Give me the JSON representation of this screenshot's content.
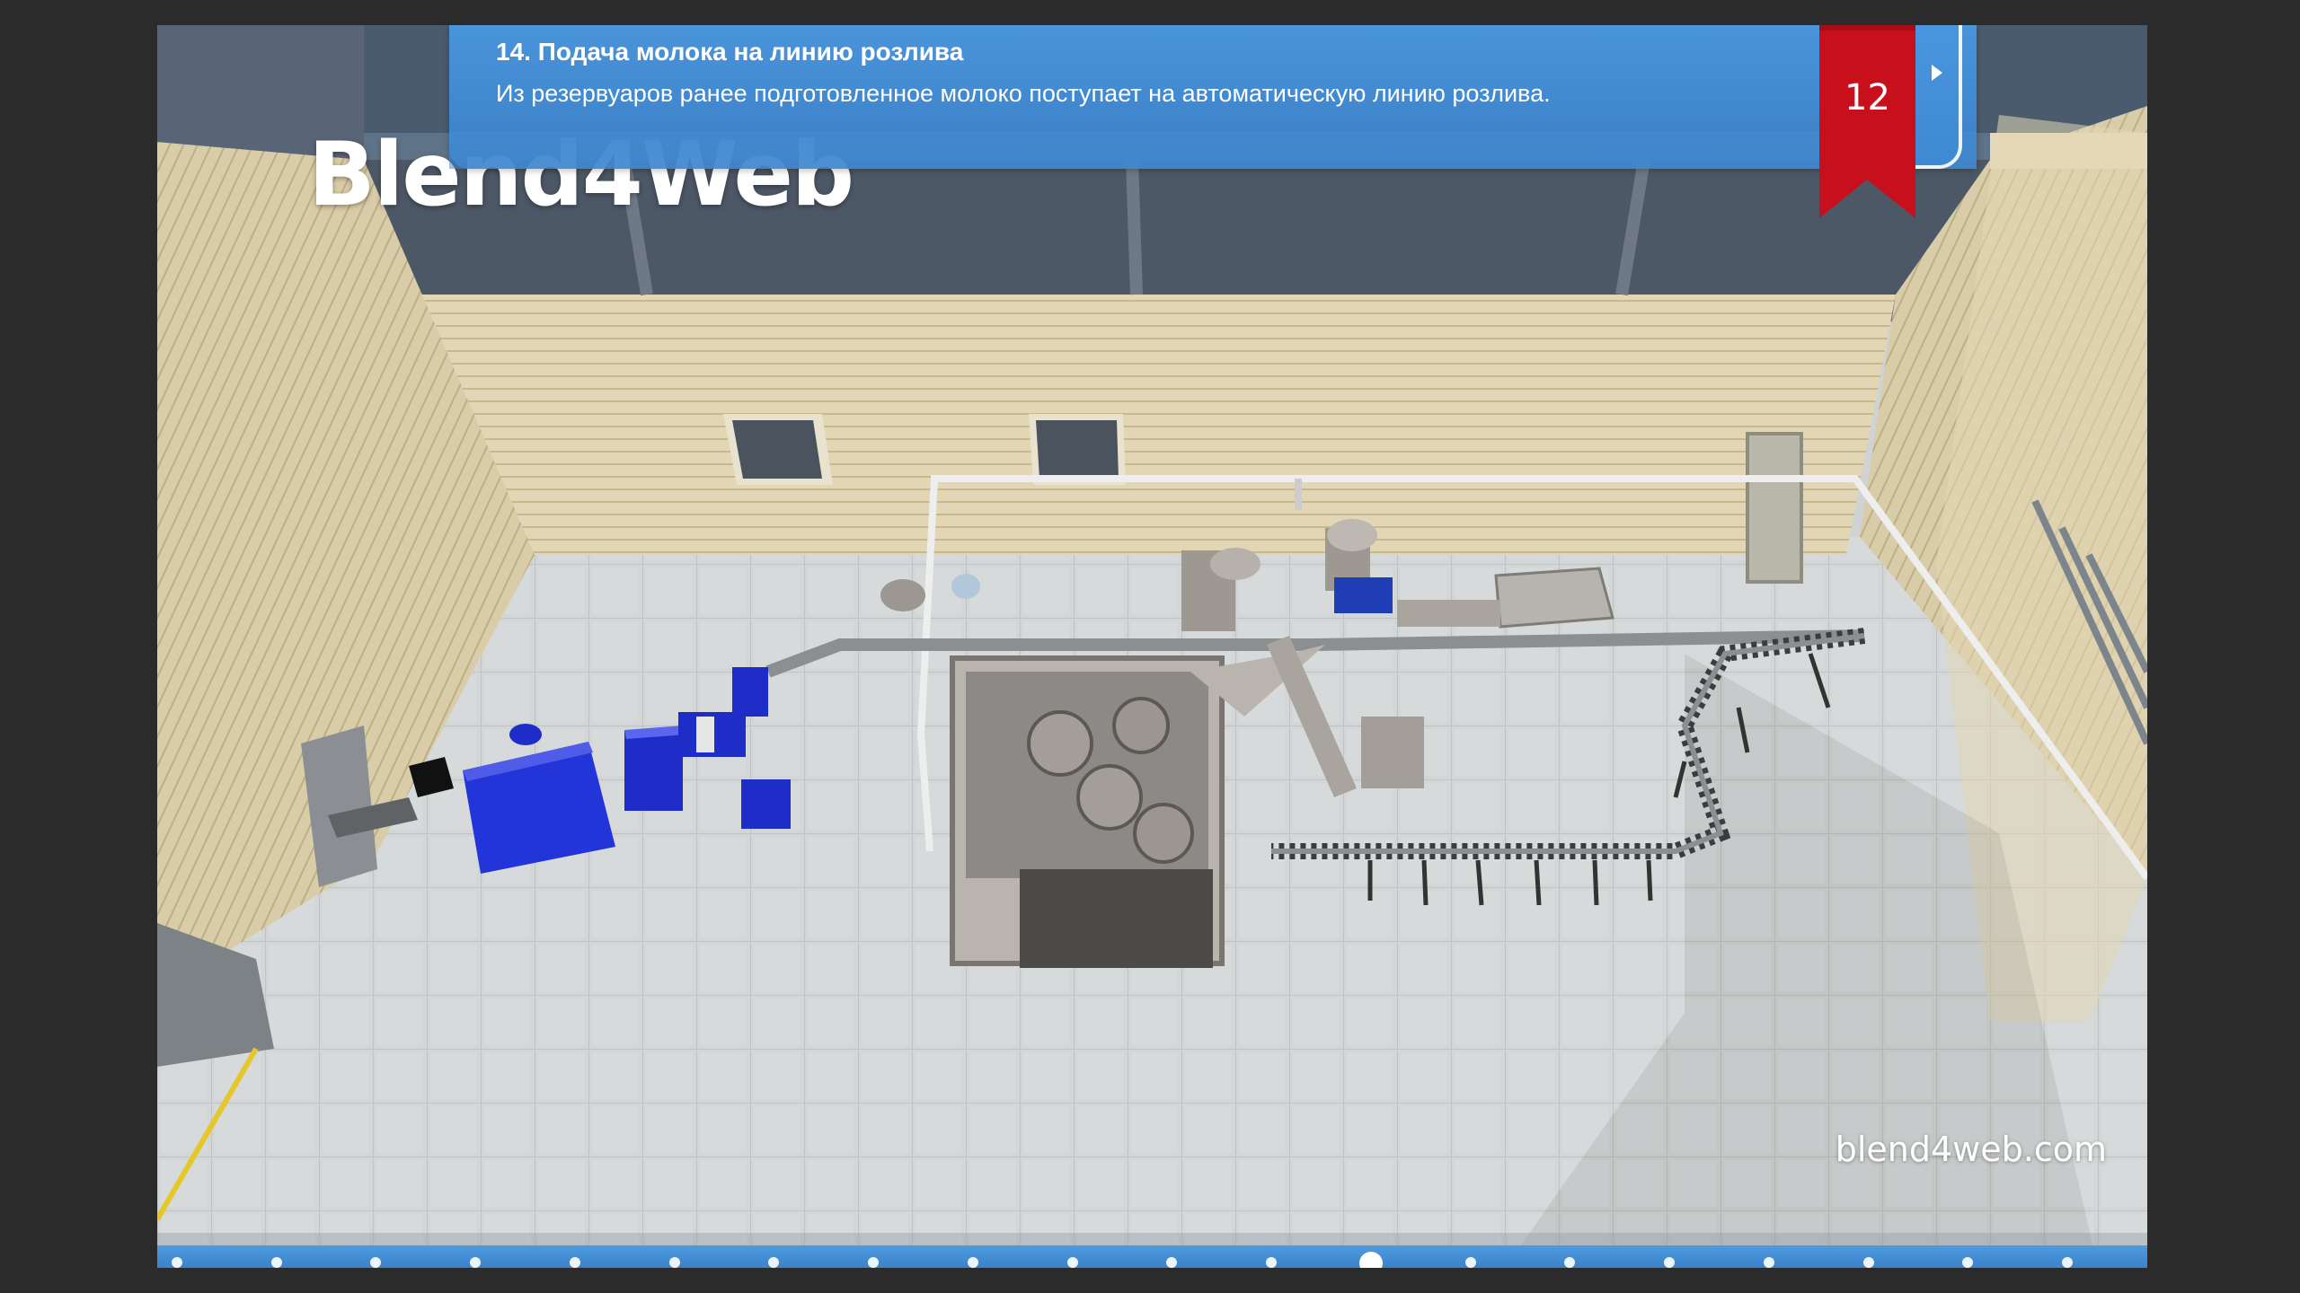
{
  "logo": {
    "text": "Blend4Web"
  },
  "site_url": "blend4web.com",
  "info": {
    "title": "14. Подача молока на линию розлива",
    "text": "Из резервуаров ранее подготовленное молоко поступает на автоматическую линию розлива."
  },
  "bookmark": {
    "number": "12",
    "color": "#c8101c"
  },
  "next_button": {
    "icon": "play-arrow-icon"
  },
  "timeline": {
    "step_count": 20,
    "active_index": 12
  },
  "colors": {
    "banner": "#4a96de",
    "timeline": "#4a94dc",
    "machine_blue": "#2a35d8"
  }
}
